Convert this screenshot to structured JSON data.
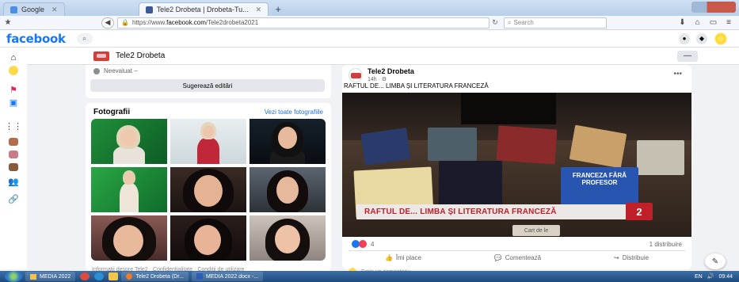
{
  "browser": {
    "tabs": [
      {
        "label": "Google",
        "active": false,
        "color": "#4d8fe6"
      },
      {
        "label": "Tele2 Drobeta | Drobeta-Tu...",
        "active": true,
        "color": "#3b5998"
      }
    ],
    "url_prefix": "https://www.",
    "url_domain": "facebook.com",
    "url_path": "/Tele2drobeta2021",
    "search_placeholder": "Search"
  },
  "facebook": {
    "logo": "facebook",
    "brand_color": "#1877f2"
  },
  "page": {
    "name": "Tele2 Drobeta",
    "more_label": "—"
  },
  "info": {
    "row_text": "Neevaluat –",
    "suggest_button": "Sugerează editări"
  },
  "photos": {
    "title": "Fotografii",
    "see_all": "Vezi toate fotografiile"
  },
  "post": {
    "author": "Tele2 Drobeta",
    "meta": "14h · ⚙",
    "caption": "RAFTUL DE... LIMBA ȘI LITERATURA FRANCEZĂ",
    "video_banner": "RAFTUL DE... LIMBA ȘI LITERATURA FRANCEZĂ",
    "video_logo": "2",
    "card_label": "Cart de le",
    "book_title": "FRANCEZA FĂRĂ PROFESOR",
    "reaction_count": "4",
    "shares": "1 distribuire",
    "actions": {
      "like": "Îmi place",
      "comment": "Comentează",
      "share": "Distribuie"
    },
    "comment_placeholder": "Scrie un comentariu..."
  },
  "footer_text": "Informații despre Tele2 · Confidențialitate · Condiții de utilizare",
  "taskbar": {
    "items": [
      "MEDIA 2022",
      "Tele2 Drobeta (Dr...",
      "MEDIA 2022.docx -..."
    ],
    "tray_lang": "EN",
    "clock": "09:44"
  }
}
